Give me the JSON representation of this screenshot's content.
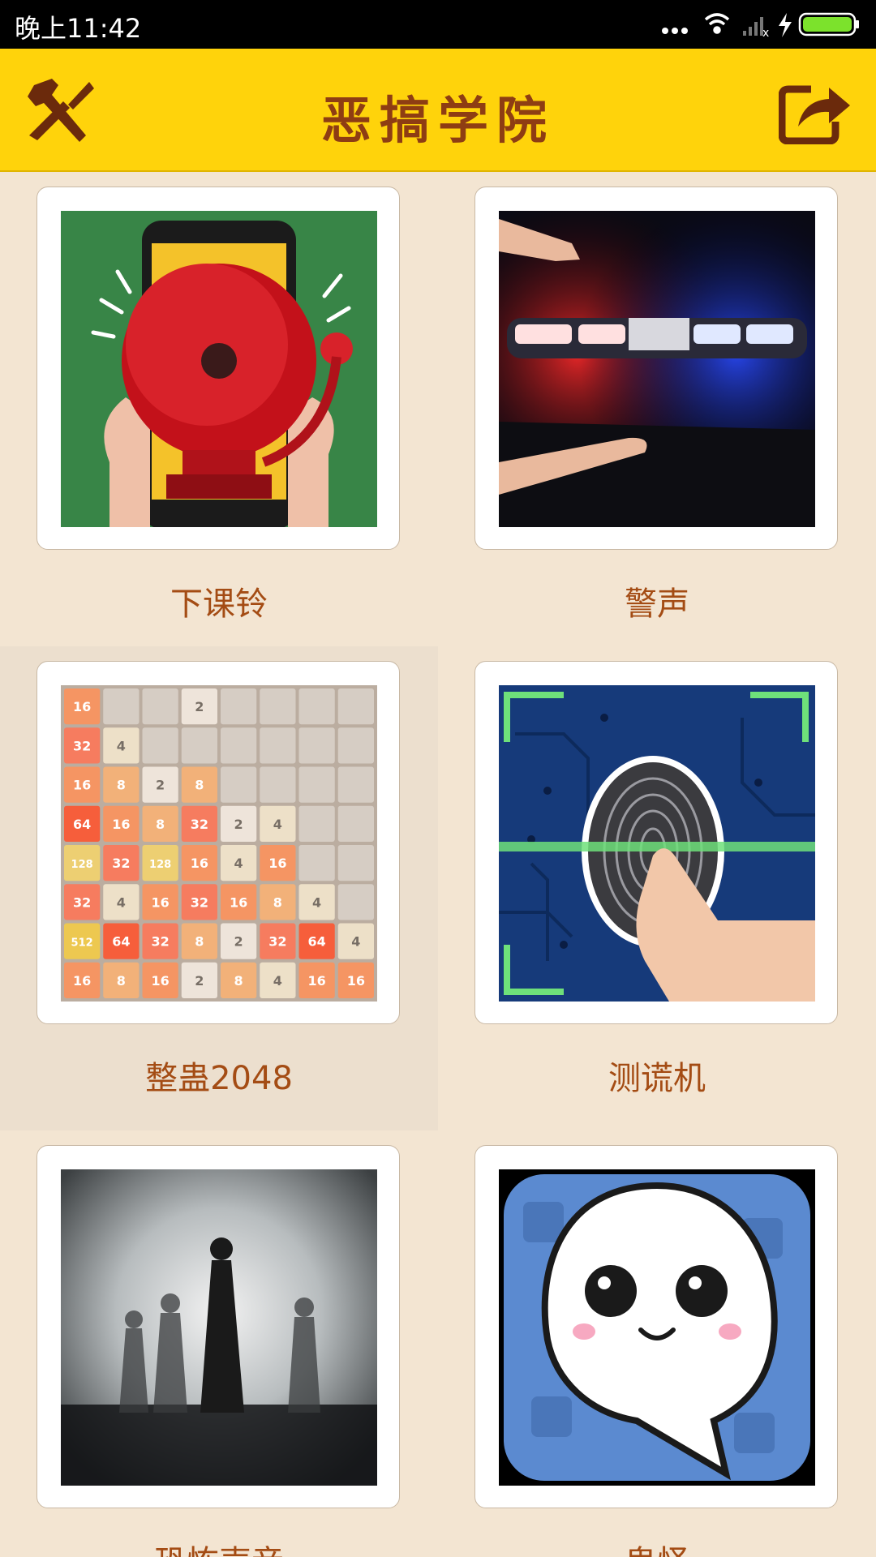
{
  "status_bar": {
    "time": "晚上11:42"
  },
  "app_bar": {
    "title": "恶搞学院"
  },
  "items": [
    {
      "label": "下课铃",
      "icon": "school-bell-icon"
    },
    {
      "label": "警声",
      "icon": "police-siren-icon"
    },
    {
      "label": "整蛊2048",
      "icon": "game-2048-icon"
    },
    {
      "label": "测谎机",
      "icon": "fingerprint-scanner-icon"
    },
    {
      "label": "恐怖声音",
      "icon": "shadow-figures-icon"
    },
    {
      "label": "鬼怪",
      "icon": "ghost-icon"
    }
  ],
  "game_2048_tiles": [
    [
      "16",
      "",
      "",
      "2",
      "",
      "",
      "",
      ""
    ],
    [
      "32",
      "4",
      "",
      "",
      "",
      "",
      "",
      ""
    ],
    [
      "16",
      "8",
      "2",
      "8",
      "",
      "",
      "",
      ""
    ],
    [
      "64",
      "16",
      "8",
      "32",
      "2",
      "4",
      "",
      ""
    ],
    [
      "128",
      "32",
      "128",
      "16",
      "4",
      "16",
      "",
      ""
    ],
    [
      "32",
      "4",
      "16",
      "32",
      "16",
      "8",
      "4",
      ""
    ],
    [
      "512",
      "64",
      "32",
      "8",
      "2",
      "32",
      "64",
      "4"
    ],
    [
      "16",
      "8",
      "16",
      "2",
      "8",
      "4",
      "16",
      "16"
    ]
  ],
  "colors": {
    "app_bar": "#ffd30b",
    "title": "#8e3d13",
    "background": "#f3e5d2",
    "label": "#a44c14"
  }
}
